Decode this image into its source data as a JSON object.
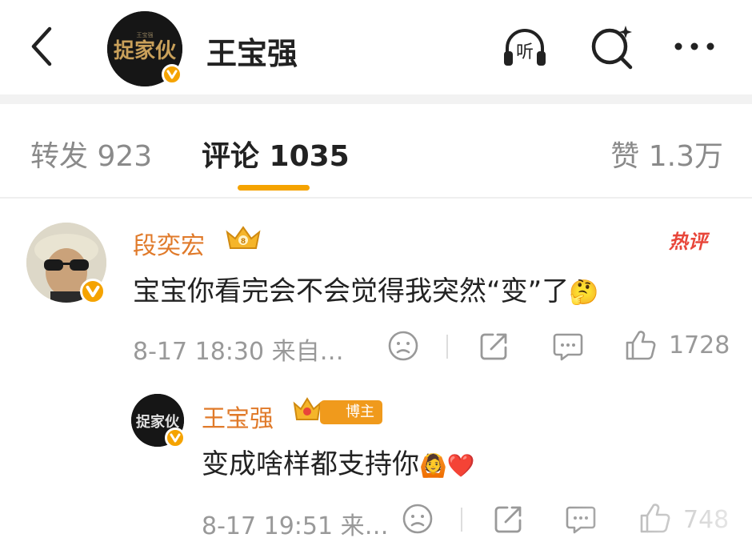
{
  "header": {
    "title": "王宝强",
    "back_icon": "chevron-left-icon",
    "listen_label": "听",
    "avatar_logo_text": "捉家伙",
    "verified_icon": "verified-v-icon"
  },
  "tabs": {
    "repost_label": "转发 923",
    "comment_label": "评论 1035",
    "like_label": "赞 1.3万"
  },
  "comment": {
    "author": "段奕宏",
    "hot_badge": "热评",
    "text": "宝宝你看完会不会觉得我突然“变”了",
    "emoji": "🤔",
    "meta": "8-17 18:30  来自…",
    "like_count": "1728"
  },
  "reply": {
    "author": "王宝强",
    "badge": "博主",
    "text": "变成啥样都支持你",
    "emoji": "🙆❤️",
    "meta": "8-17 19:51  来…",
    "like_count": "748"
  },
  "colors": {
    "accent": "#f5a300",
    "name": "#e07a2a",
    "hot": "#e8463a",
    "muted": "#999999"
  }
}
